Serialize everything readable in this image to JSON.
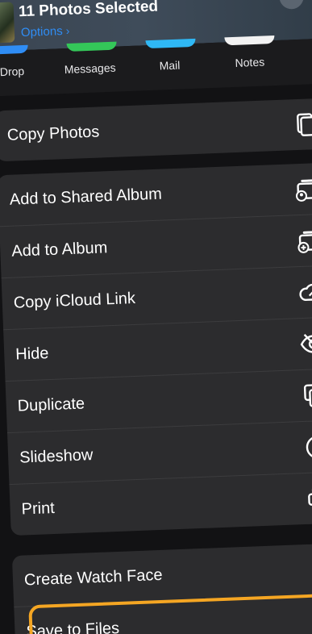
{
  "header": {
    "title": "11 Photos Selected",
    "options_label": "Options",
    "options_chevron": "›",
    "close_glyph": "✕"
  },
  "apps": [
    {
      "label": "Drop",
      "color": "#2f8df5"
    },
    {
      "label": "Messages",
      "color": "#34c759"
    },
    {
      "label": "Mail",
      "color": "#2fb8f5"
    },
    {
      "label": "Notes",
      "color": "#f2f2f2"
    }
  ],
  "group_copy": [
    {
      "label": "Copy Photos",
      "icon": "copy-icon"
    }
  ],
  "group_album": [
    {
      "label": "Add to Shared Album",
      "icon": "shared-album-icon"
    },
    {
      "label": "Add to Album",
      "icon": "add-album-icon"
    },
    {
      "label": "Copy iCloud Link",
      "icon": "icloud-link-icon"
    },
    {
      "label": "Hide",
      "icon": "eye-slash-icon"
    },
    {
      "label": "Duplicate",
      "icon": "duplicate-icon"
    },
    {
      "label": "Slideshow",
      "icon": "play-icon"
    },
    {
      "label": "Print",
      "icon": "printer-icon"
    }
  ],
  "group_extra": [
    {
      "label": "Create Watch Face",
      "icon": "watch-icon"
    },
    {
      "label": "Save to Files",
      "icon": "folder-icon",
      "highlighted": true
    }
  ],
  "colors": {
    "accent": "#2f8df5",
    "highlight": "#f5a623",
    "cell_background": "#2c2c2e"
  }
}
